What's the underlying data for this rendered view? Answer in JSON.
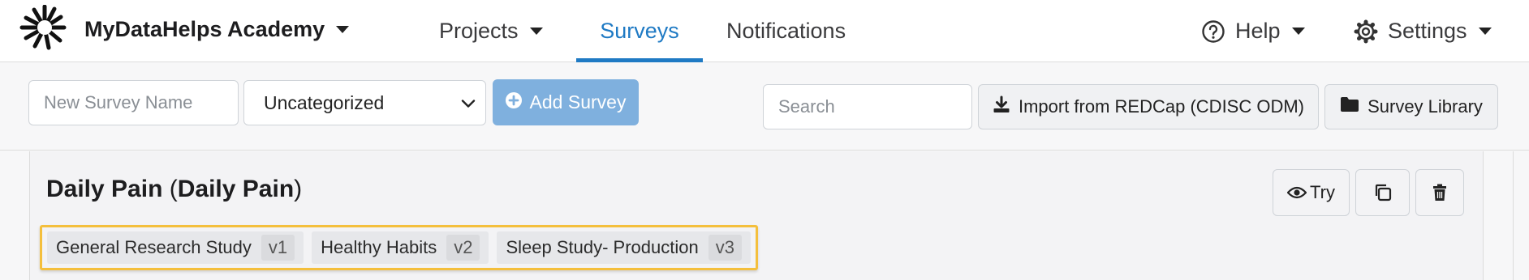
{
  "brand": {
    "name": "MyDataHelps Academy"
  },
  "nav": {
    "projects": "Projects",
    "surveys": "Surveys",
    "notifications": "Notifications",
    "help": "Help",
    "settings": "Settings"
  },
  "toolbar": {
    "new_survey_placeholder": "New Survey Name",
    "category_selected": "Uncategorized",
    "add_survey_label": "Add Survey",
    "search_placeholder": "Search",
    "import_label": "Import from REDCap (CDISC ODM)",
    "library_label": "Survey Library"
  },
  "survey": {
    "name": "Daily Pain",
    "display_name": "Daily Pain",
    "paren_open": "(",
    "paren_close": ")",
    "try_label": "Try",
    "projects": [
      {
        "name": "General Research Study",
        "version": "v1"
      },
      {
        "name": "Healthy Habits",
        "version": "v2"
      },
      {
        "name": "Sleep Study- Production",
        "version": "v3"
      }
    ]
  },
  "colors": {
    "accent": "#1f7ac4",
    "primary_button": "#7fb0de",
    "highlight_border": "#f4bf3c"
  },
  "icons": {
    "brand": "sunburst-logo-icon",
    "help": "question-circle-icon",
    "settings": "gear-icon",
    "add": "plus-circle-icon",
    "import": "download-icon",
    "library": "folder-icon",
    "try": "eye-icon",
    "copy": "copy-icon",
    "delete": "trash-icon"
  }
}
